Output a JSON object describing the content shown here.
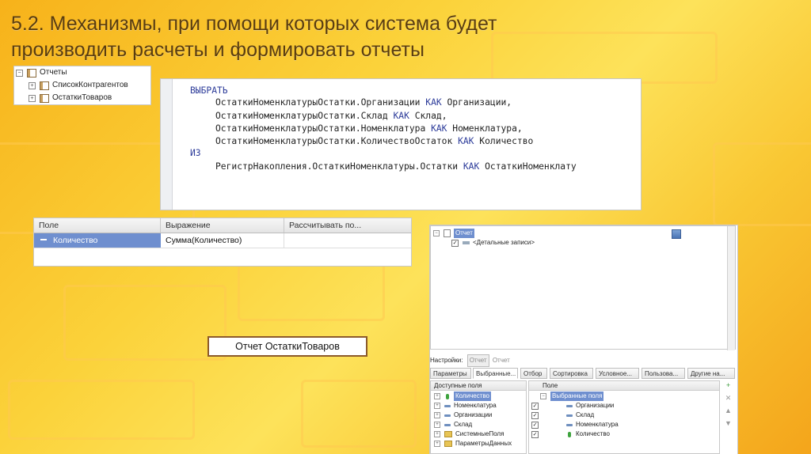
{
  "slide": {
    "title_line1": "5.2. Механизмы, при помощи которых система будет",
    "title_line2": "производить расчеты и формировать отчеты"
  },
  "tree": {
    "root": "Отчеты",
    "items": [
      "СписокКонтрагентов",
      "ОстаткиТоваров"
    ]
  },
  "query": {
    "select_kw": "ВЫБРАТЬ",
    "lines": [
      {
        "expr": "ОстаткиНоменклатурыОстатки.Организации",
        "kw": "КАК",
        "alias": "Организации,"
      },
      {
        "expr": "ОстаткиНоменклатурыОстатки.Склад",
        "kw": "КАК",
        "alias": "Склад,"
      },
      {
        "expr": "ОстаткиНоменклатурыОстатки.Номенклатура",
        "kw": "КАК",
        "alias": "Номенклатура,"
      },
      {
        "expr": "ОстаткиНоменклатурыОстатки.КоличествоОстаток",
        "kw": "КАК",
        "alias": "Количество"
      }
    ],
    "from_kw": "ИЗ",
    "from_expr": "РегистрНакопления.ОстаткиНоменклатуры.Остатки",
    "from_kw2": "КАК",
    "from_alias": "ОстаткиНоменклату"
  },
  "resources": {
    "headers": [
      "Поле",
      "Выражение",
      "Рассчитывать по..."
    ],
    "row": {
      "field": "Количество",
      "expression": "Сумма(Количество)",
      "calc_by": ""
    }
  },
  "label": "Отчет ОстаткиТоваров",
  "composer": {
    "tree_root": "Отчет",
    "tree_child": "<Детальные записи>",
    "settings_label": "Настройки:",
    "settings_btn": "Отчет",
    "settings_value": "Отчет",
    "tabs": [
      "Параметры",
      "Выбранные...",
      "Отбор",
      "Сортировка",
      "Условное...",
      "Пользова...",
      "Другие на..."
    ],
    "available_header": "Доступные поля",
    "available": [
      "Количество",
      "Номенклатура",
      "Организации",
      "Склад",
      "СистемныеПоля",
      "ПараметрыДанных"
    ],
    "selected_header": "Поле",
    "selected_root": "Выбранные поля",
    "selected": [
      "Организации",
      "Склад",
      "Номенклатура",
      "Количество"
    ]
  }
}
